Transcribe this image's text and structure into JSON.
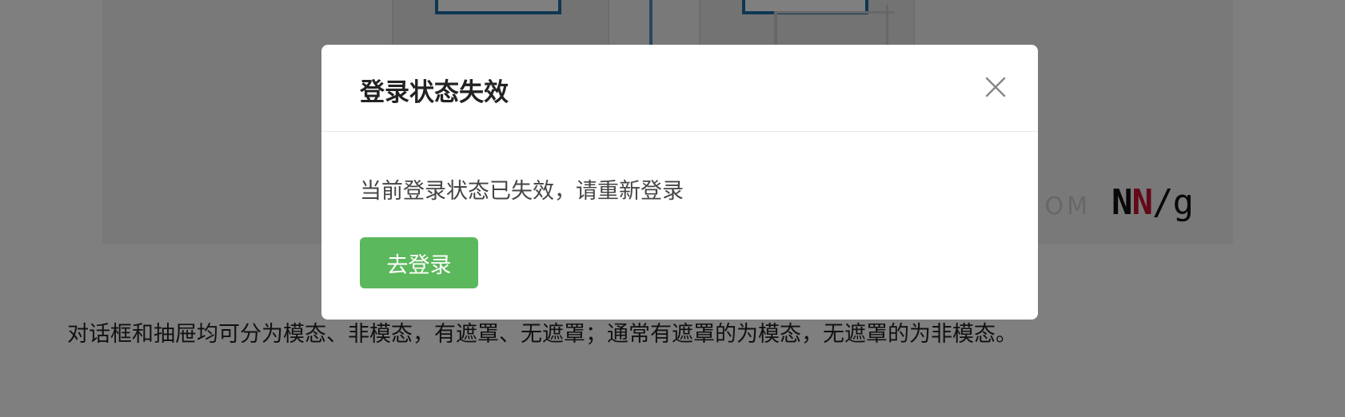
{
  "article": {
    "watermark_faded": "OM",
    "logo": {
      "n1": "N",
      "n2": "N",
      "slash": "/",
      "g": "g"
    },
    "paragraph": "对话框和抽屉均可分为模态、非模态，有遮罩、无遮罩；通常有遮罩的为模态，无遮罩的为非模态。"
  },
  "modal": {
    "title": "登录状态失效",
    "message": "当前登录状态已失效，请重新登录",
    "primary_button": "去登录",
    "close_icon": "close-icon"
  },
  "colors": {
    "primary_button": "#5cb85c",
    "overlay": "rgba(0,0,0,0.5)",
    "logo_red": "#c8102e",
    "wireframe_blue": "#1f6fa3"
  }
}
